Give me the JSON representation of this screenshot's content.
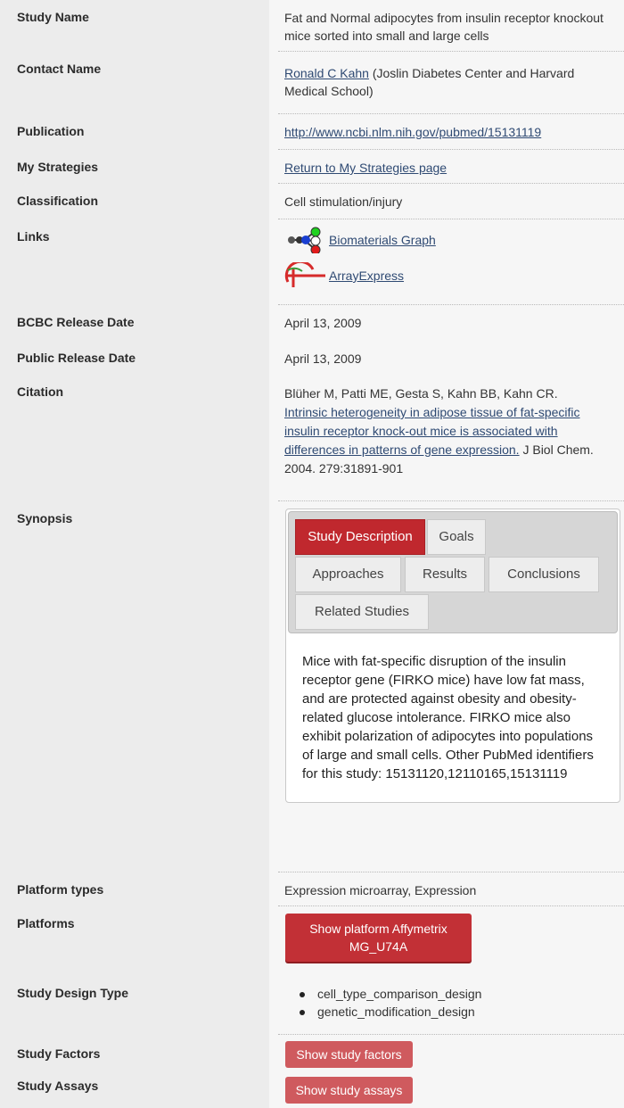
{
  "rows": {
    "study_name": {
      "label": "Study Name",
      "value": "Fat and Normal adipocytes from insulin receptor knockout mice sorted into small and large cells"
    },
    "contact": {
      "label": "Contact Name",
      "link": "Ronald C Kahn",
      "rest": " (Joslin Diabetes Center and Harvard Medical School)"
    },
    "publication": {
      "label": "Publication",
      "link": "http://www.ncbi.nlm.nih.gov/pubmed/15131119"
    },
    "strategies": {
      "label": "My Strategies",
      "link": "Return to My Strategies page"
    },
    "classification": {
      "label": "Classification",
      "value": "Cell stimulation/injury"
    },
    "links": {
      "label": "Links",
      "graph": "Biomaterials Graph",
      "arrayexpress": "ArrayExpress",
      "graph_icon": "biomaterials-graph-icon",
      "arrayexpress_icon": "arrayexpress-icon"
    },
    "bcbc_date": {
      "label": "BCBC Release Date",
      "value": "April 13, 2009"
    },
    "public_date": {
      "label": "Public Release Date",
      "value": "April 13, 2009"
    },
    "citation": {
      "label": "Citation",
      "authors": "Blüher M, Patti ME, Gesta S, Kahn BB, Kahn CR.",
      "title": "Intrinsic heterogeneity in adipose tissue of fat-specific insulin receptor knock-out mice is associated with differences in patterns of gene expression.",
      "journal": " J Biol Chem. 2004. 279:31891-901"
    },
    "synopsis": {
      "label": "Synopsis",
      "tabs": [
        "Study Description",
        "Goals",
        "Approaches",
        "Results",
        "Conclusions",
        "Related Studies"
      ],
      "active_tab": "Study Description",
      "text": "Mice with fat-specific disruption of the insulin receptor gene (FIRKO mice) have low fat mass, and are protected against obesity and obesity-related glucose intolerance. FIRKO mice also exhibit polarization of adipocytes into populations of large and small cells. Other PubMed identifiers for this study: 15131120,12110165,15131119"
    },
    "platform_types": {
      "label": "Platform types",
      "value": "Expression microarray, Expression"
    },
    "platforms": {
      "label": "Platforms",
      "button": "Show platform Affymetrix MG_U74A"
    },
    "design": {
      "label": "Study Design Type",
      "items": [
        "cell_type_comparison_design",
        "genetic_modification_design"
      ]
    },
    "factors": {
      "label": "Study Factors",
      "button": "Show study factors"
    },
    "assays": {
      "label": "Study Assays",
      "button": "Show study assays"
    }
  },
  "colors": {
    "accent": "#c0282e",
    "link": "#2f4a73",
    "label_bg": "#ececec",
    "value_bg": "#f6f6f6"
  }
}
